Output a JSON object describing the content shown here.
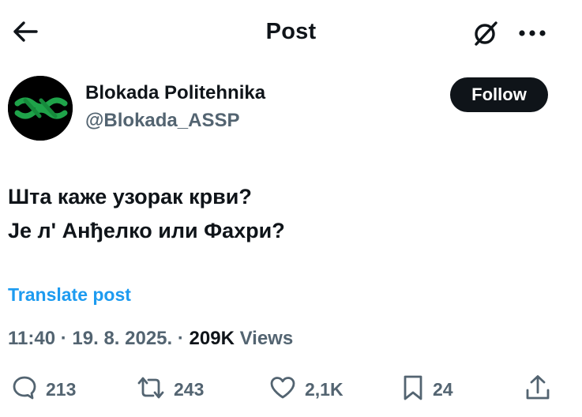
{
  "header": {
    "title": "Post"
  },
  "author": {
    "display_name": "Blokada Politehnika",
    "handle": "@Blokada_ASSP",
    "follow_label": "Follow",
    "avatar_colors": {
      "background": "#000000",
      "logo": "#1fa34a"
    }
  },
  "post": {
    "lines": [
      "Шта каже узорак крви?",
      "Је л' Анђелко или Фахри?"
    ],
    "translate_label": "Translate post",
    "time": "11:40",
    "date": "19. 8. 2025.",
    "views_count": "209K",
    "views_label": "Views"
  },
  "actions": {
    "replies": "213",
    "reposts": "243",
    "likes": "2,1K",
    "bookmarks": "24"
  },
  "icons": {
    "back": "arrow-left-icon",
    "grok": "grok-icon",
    "more": "more-horizontal-icon",
    "reply": "reply-icon",
    "repost": "repost-icon",
    "like": "heart-icon",
    "bookmark": "bookmark-icon",
    "share": "share-icon"
  },
  "colors": {
    "text": "#0f1419",
    "secondary": "#536471",
    "accent": "#1d9bf0",
    "follow_bg": "#0f1419"
  }
}
